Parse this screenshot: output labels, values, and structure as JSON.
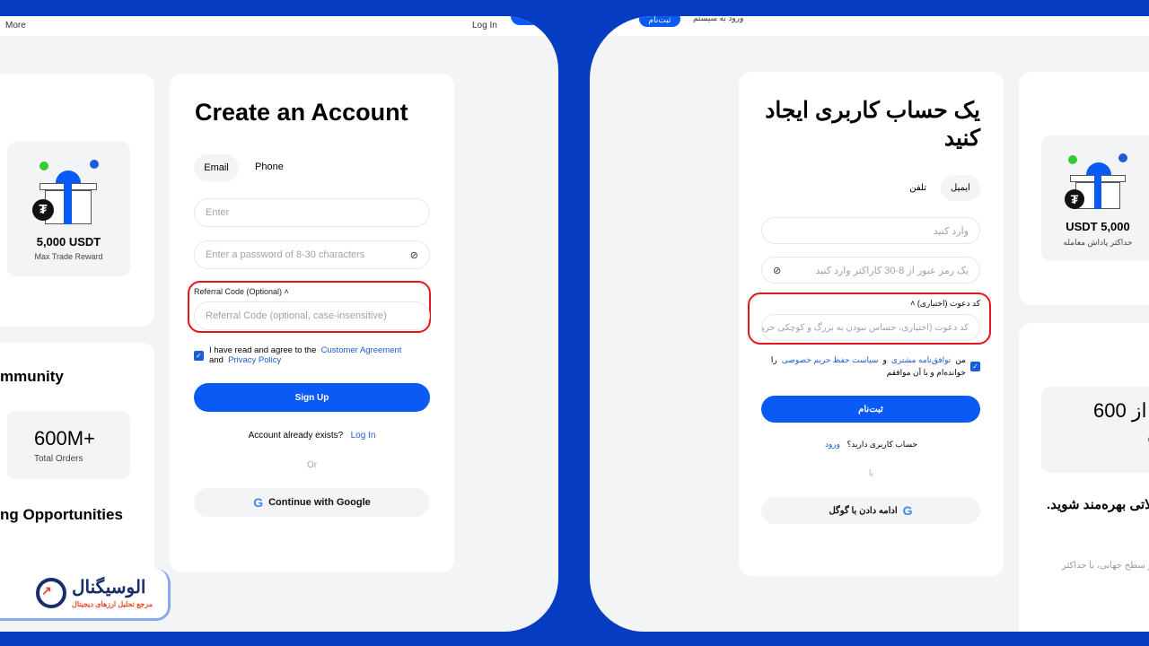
{
  "left": {
    "header": {
      "more": "More",
      "login": "Log In"
    },
    "reward": {
      "amount": "5,000 USDT",
      "label": "Max Trade Reward"
    },
    "community": {
      "heading": "mmunity",
      "stat": "600M+",
      "stat_label": "Total Orders",
      "opportunities": "ng Opportunities"
    },
    "form": {
      "title": "Create an Account",
      "tabs": [
        "Email",
        "Phone"
      ],
      "email_placeholder": "Enter",
      "password_placeholder": "Enter a password of 8-30 characters",
      "referral_label": "Referral Code (Optional)",
      "referral_placeholder": "Referral Code (optional, case-insensitive)",
      "agree_prefix": "I have read and agree to the",
      "agreement": "Customer Agreement",
      "and": "and",
      "privacy": "Privacy Policy",
      "signup": "Sign Up",
      "exists": "Account already exists?",
      "login": "Log In",
      "or": "Or",
      "google": "Continue with Google"
    }
  },
  "right": {
    "header": {
      "register": "ثبت‌نام",
      "login": "ورود به سیستم"
    },
    "reward": {
      "amount": "USDT 5,000",
      "label": "حداکثر پاداش معامله"
    },
    "community": {
      "stat": "از 600",
      "stat2": "ن",
      "stat_label": "ها",
      "heading": "لاتی بهره‌مند شوید.",
      "desc": "ر سطح جهانی، با حداکثر"
    },
    "form": {
      "title": "یک حساب کاربری ایجاد کنید",
      "tabs": [
        "ایمیل",
        "تلفن"
      ],
      "email_placeholder": "وارد کنید",
      "password_placeholder": "یک رمز عبور از 8-30 کاراکتر وارد کنید",
      "referral_label": "کد دعوت (اختیاری)",
      "referral_placeholder": "کد دعوت (اختیاری، حساس نبودن به بزرگ و کوچکی حرو",
      "agree_prefix": "من",
      "agreement": "توافق‌نامه مشتری",
      "and": "و",
      "privacy": "سیاست حفظ حریم خصوصی",
      "agree_suffix": "را خوانده‌ام و با آن موافقم",
      "signup": "ثبت‌نام",
      "exists": "حساب کاربری دارید؟",
      "login": "ورود",
      "or": "یا",
      "google": "ادامه دادن با گوگل"
    }
  },
  "watermark": {
    "name": "الوسیگنال",
    "tagline": "مرجع تحلیل ارزهای دیجیتال"
  },
  "colors": {
    "frame": "#063cc2",
    "accent": "#0a5af5",
    "highlight": "#e8141c"
  }
}
